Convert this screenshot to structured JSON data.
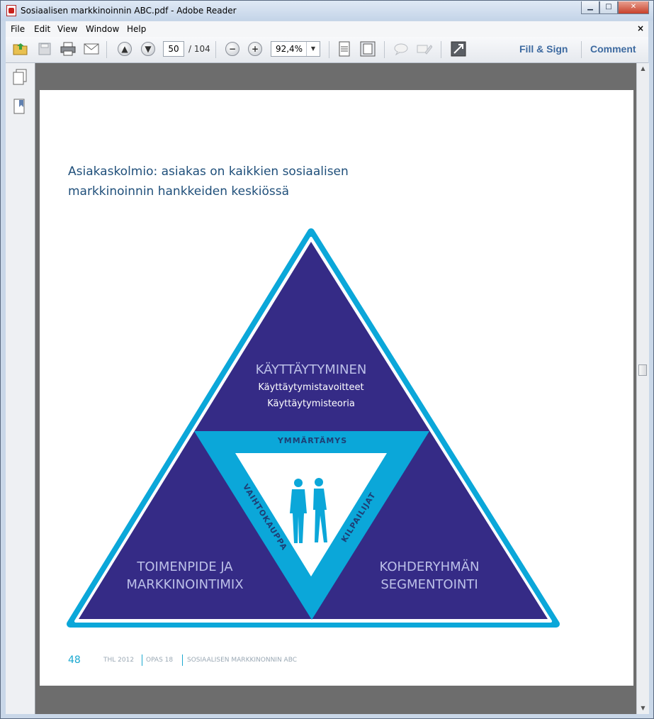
{
  "window": {
    "title": "Sosiaalisen markkinoinnin ABC.pdf - Adobe Reader",
    "controls": {
      "minimize": "▁",
      "maximize": "□",
      "close": "✕"
    }
  },
  "menu": {
    "items": [
      "File",
      "Edit",
      "View",
      "Window",
      "Help"
    ],
    "close_doc": "×"
  },
  "toolbar": {
    "page_current": "50",
    "page_total": "/ 104",
    "zoom_value": "92,4%",
    "zoom_dropdown": "▼",
    "fill_sign": "Fill & Sign",
    "comment": "Comment",
    "icons": [
      "open-icon",
      "save-icon",
      "print-icon",
      "email-icon",
      "prev-page-icon",
      "next-page-icon",
      "zoom-out-icon",
      "zoom-in-icon",
      "fit-page-icon",
      "fit-width-icon",
      "sticky-note-icon",
      "highlight-icon",
      "full-screen-icon"
    ]
  },
  "scrollbar": {
    "up": "▲",
    "down": "▼"
  },
  "document": {
    "heading_line1": "Asiakaskolmio: asiakas on kaikkien sosiaalisen",
    "heading_line2": "markkinoinnin hankkeiden keskiössä",
    "triangle": {
      "top_title": "KÄYTTÄYTYMINEN",
      "top_line1": "Käyttäytymistavoitteet",
      "top_line2": "Käyttäytymisteoria",
      "band_top": "YMMÄRTÄMYS",
      "band_left": "VAIHTOKAUPPA",
      "band_right": "KILPAILIJAT",
      "left_line1": "TOIMENPIDE JA",
      "left_line2": "MARKKINOINTIMIX",
      "right_line1": "KOHDERYHMÄN",
      "right_line2": "SEGMENTOINTI",
      "colors": {
        "dark": "#352b86",
        "light": "#0ba7d9",
        "white": "#ffffff"
      }
    },
    "footer": {
      "page_number": "48",
      "part1": "THL 2012",
      "part2": "OPAS 18",
      "part3": "SOSIAALISEN MARKKINONNIN ABC"
    }
  }
}
